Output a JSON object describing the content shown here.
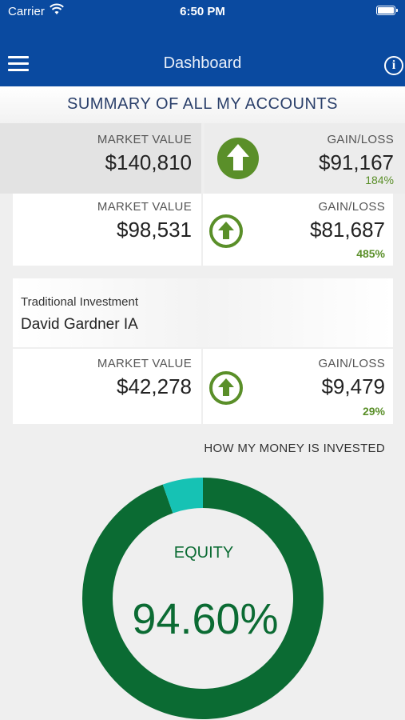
{
  "status_bar": {
    "carrier": "Carrier",
    "time": "6:50 PM"
  },
  "nav": {
    "title": "Dashboard",
    "menu_icon": "hamburger-menu-icon",
    "info_icon": "info-icon",
    "info_glyph": "i"
  },
  "summary": {
    "title": "SUMMARY OF ALL MY ACCOUNTS",
    "market_value_label": "MARKET VALUE",
    "market_value": "$140,810",
    "gain_loss_label": "GAIN/LOSS",
    "gain_loss": "$91,167",
    "gain_pct": "184%"
  },
  "account_group": {
    "market_value_label": "MARKET VALUE",
    "market_value": "$98,531",
    "gain_loss_label": "GAIN/LOSS",
    "gain_loss": "$81,687",
    "gain_pct": "485%"
  },
  "account": {
    "type": "Traditional Investment",
    "name": "David Gardner IA",
    "market_value_label": "MARKET VALUE",
    "market_value": "$42,278",
    "gain_loss_label": "GAIN/LOSS",
    "gain_loss": "$9,479",
    "gain_pct": "29%"
  },
  "allocation": {
    "title": "HOW MY MONEY IS INVESTED",
    "center_label": "EQUITY",
    "center_value": "94.60%"
  },
  "colors": {
    "header": "#0a4aa0",
    "gain": "#5a8f29",
    "equity": "#0b6b33",
    "other": "#16c2b4"
  },
  "chart_data": {
    "type": "pie",
    "categories": [
      "EQUITY",
      ""
    ],
    "values": [
      94.6,
      5.4
    ],
    "title": "HOW MY MONEY IS INVESTED"
  }
}
